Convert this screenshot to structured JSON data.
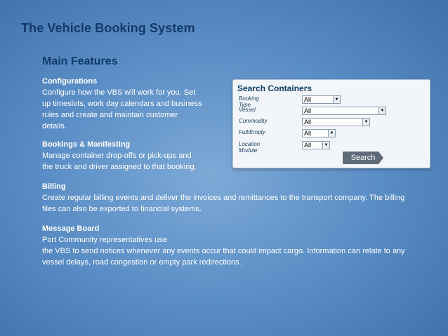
{
  "title": "The Vehicle Booking System",
  "subtitle": "Main Features",
  "sections": [
    {
      "heading": "Configurations",
      "lines": [
        "Configure how the VBS will work for you.  Set",
        "up timeslots, work day calendars and business",
        "rules and create and maintain customer",
        "details."
      ]
    },
    {
      "heading": "Bookings & Manifesting",
      "lines": [
        "Manage container drop-offs or pick-ups and",
        "the truck and driver assigned to that booking."
      ]
    },
    {
      "heading": "Billing",
      "lines": [
        "Create regular billing events and deliver the invoices and remittances to the transport company.  The billing",
        "files can also be exported to financial systems."
      ]
    },
    {
      "heading": "Message Board",
      "lines": [
        "Port Community representatives use",
        "the VBS to send notices whenever any events occur that could impact cargo.  Information can relate to any",
        "vessel delays, road congestion or empty park redirections."
      ]
    }
  ],
  "search_panel": {
    "title": "Search Containers",
    "fields": [
      {
        "label": "Booking Type",
        "value": "All"
      },
      {
        "label": "Vessel",
        "value": "All"
      },
      {
        "label": "Commodity",
        "value": "All"
      },
      {
        "label": "Full/Empty",
        "value": "All"
      },
      {
        "label": "Location Module",
        "value": "All"
      }
    ],
    "dropdown_arrow": "▼",
    "button_label": "Search"
  }
}
